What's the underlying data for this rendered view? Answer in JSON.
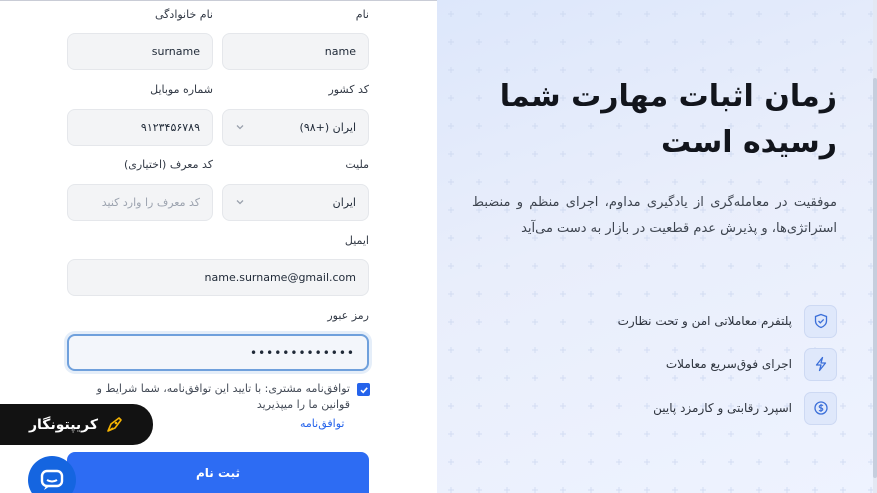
{
  "form": {
    "first_name": {
      "label": "نام",
      "value": "name"
    },
    "last_name": {
      "label": "نام خانوادگی",
      "value": "surname"
    },
    "country_code": {
      "label": "کد کشور",
      "value": "ایران (+۹۸)"
    },
    "mobile": {
      "label": "شماره موبایل",
      "value": "۹۱۲۳۴۵۶۷۸۹"
    },
    "nationality": {
      "label": "ملیت",
      "value": "ایران"
    },
    "referral": {
      "label": "کد معرف (اختیاری)",
      "placeholder": "کد معرف را وارد کنید"
    },
    "email": {
      "label": "ایمیل",
      "value": "name.surname@gmail.com"
    },
    "password": {
      "label": "رمز عبور",
      "value": "•••••••••••••"
    },
    "terms": {
      "text": "توافق‌نامه مشتری: با تایید این توافق‌نامه، شما شرایط و قوانین ما را میپذیرید",
      "link": "توافق‌نامه",
      "checked": true
    },
    "submit_label": "ثبت نام"
  },
  "brand": {
    "name": "کریپتونگار"
  },
  "hero": {
    "title": "زمان اثبات مهارت شما رسیده است",
    "description": "موفقیت در معامله‌گری از یادگیری مداوم، اجرای منظم و منضبط استراتژی‌ها، و پذیرش عدم قطعیت در بازار به دست می‌آید",
    "features": [
      {
        "icon": "shield-icon",
        "text": "پلتفرم معاملاتی امن و تحت نظارت"
      },
      {
        "icon": "lightning-icon",
        "text": "اجرای فوق‌سریع معاملات"
      },
      {
        "icon": "dollar-coin-icon",
        "text": "اسپرد رقابتی و کارمزد پایین"
      }
    ]
  },
  "colors": {
    "primary": "#2d6cf3",
    "chat": "#1565e0",
    "badge": "#121212",
    "brand_accent": "#f5b301"
  }
}
